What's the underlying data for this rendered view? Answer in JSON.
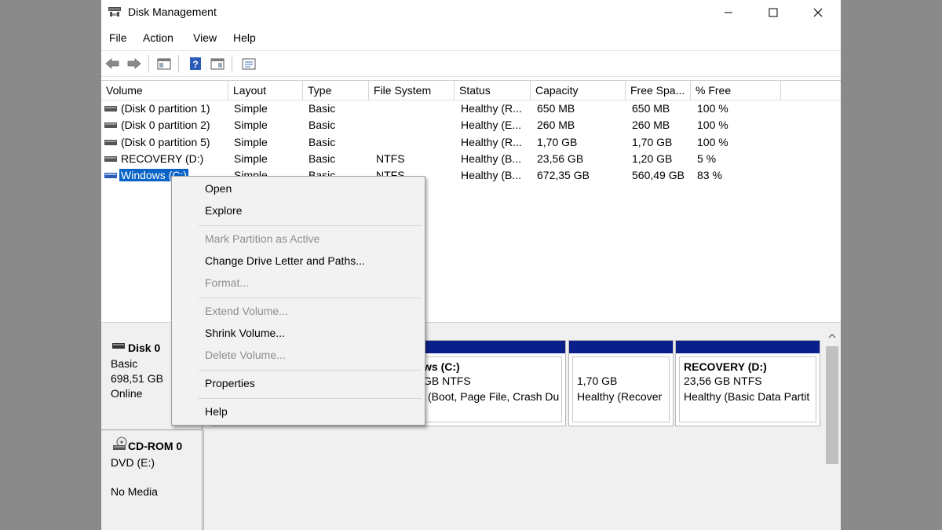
{
  "window": {
    "title": "Disk Management",
    "icon": "disk-management-icon",
    "controls": {
      "minimize": "minimize-icon",
      "maximize": "maximize-icon",
      "close": "close-icon"
    }
  },
  "menu": {
    "file": "File",
    "action": "Action",
    "view": "View",
    "help": "Help"
  },
  "toolbar": [
    "back-arrow-icon",
    "forward-arrow-icon",
    "show-hide-console-tree-icon",
    "help-icon",
    "view-pane-icon",
    "properties-list-icon"
  ],
  "volume_list": {
    "headers": {
      "volume": "Volume",
      "layout": "Layout",
      "type": "Type",
      "filesystem": "File System",
      "status": "Status",
      "capacity": "Capacity",
      "free": "Free Spa...",
      "pct": "% Free"
    },
    "rows": [
      {
        "volume": "(Disk 0 partition 1)",
        "layout": "Simple",
        "type": "Basic",
        "filesystem": "",
        "status": "Healthy (R...",
        "capacity": "650 MB",
        "free": "650 MB",
        "pct": "100 %"
      },
      {
        "volume": "(Disk 0 partition 2)",
        "layout": "Simple",
        "type": "Basic",
        "filesystem": "",
        "status": "Healthy (E...",
        "capacity": "260 MB",
        "free": "260 MB",
        "pct": "100 %"
      },
      {
        "volume": "(Disk 0 partition 5)",
        "layout": "Simple",
        "type": "Basic",
        "filesystem": "",
        "status": "Healthy (R...",
        "capacity": "1,70 GB",
        "free": "1,70 GB",
        "pct": "100 %"
      },
      {
        "volume": "RECOVERY (D:)",
        "layout": "Simple",
        "type": "Basic",
        "filesystem": "NTFS",
        "status": "Healthy (B...",
        "capacity": "23,56 GB",
        "free": "1,20 GB",
        "pct": "5 %"
      },
      {
        "volume": "Windows (C:)",
        "layout": "Simple",
        "type": "Basic",
        "filesystem": "NTFS",
        "status": "Healthy (B...",
        "capacity": "672,35 GB",
        "free": "560,49 GB",
        "pct": "83 %"
      }
    ]
  },
  "disk0": {
    "name": "Disk 0",
    "lines": [
      "Basic",
      "698,51 GB",
      "Online"
    ],
    "partitions": [
      {
        "lines": [
          "ws  (C:)",
          "GB NTFS",
          "(Boot, Page File, Crash Du"
        ]
      },
      {
        "lines": [
          "1,70 GB",
          "Healthy (Recover"
        ]
      },
      {
        "title": "RECOVERY  (D:)",
        "lines": [
          "23,56 GB NTFS",
          "Healthy (Basic Data Partit"
        ]
      }
    ]
  },
  "cdrom0": {
    "name": "CD-ROM 0",
    "lines": [
      "DVD (E:)",
      "No Media"
    ]
  },
  "context_menu": {
    "open": "Open",
    "explore": "Explore",
    "mark_active": "Mark Partition as Active",
    "change_letter": "Change Drive Letter and Paths...",
    "format": "Format...",
    "extend": "Extend Volume...",
    "shrink": "Shrink Volume...",
    "delete": "Delete Volume...",
    "properties": "Properties",
    "help": "Help"
  },
  "colors": {
    "selection": "#0a64c8",
    "partition_bar": "#0b1f8a",
    "disabled_text": "#8d8d8d"
  }
}
